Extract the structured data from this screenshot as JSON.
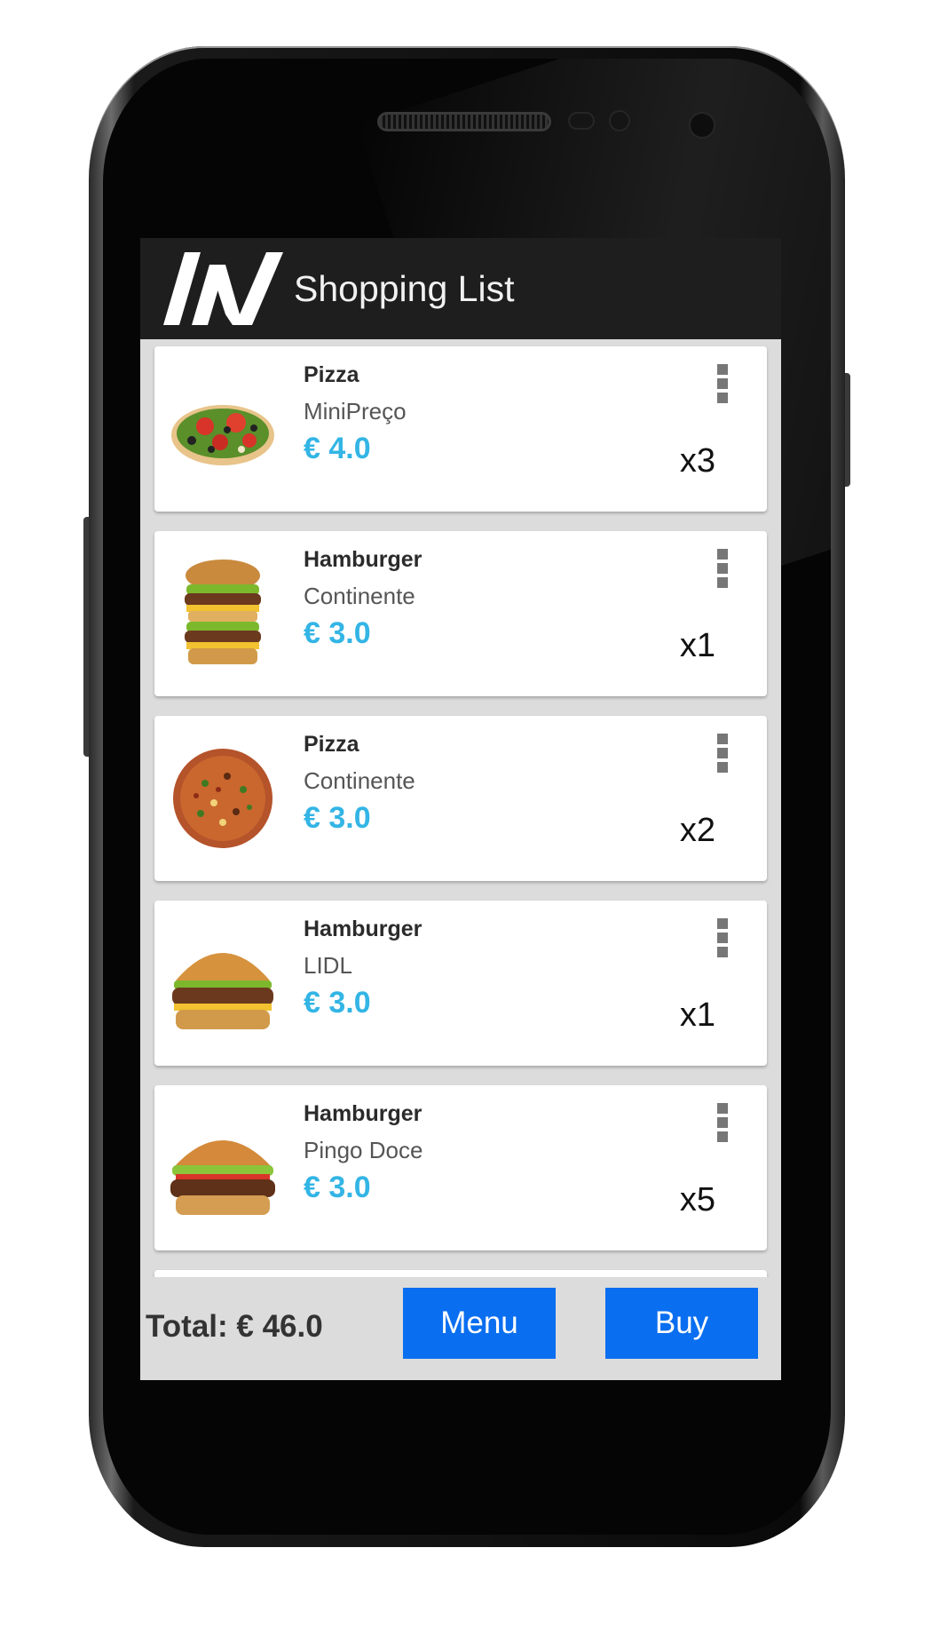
{
  "app": {
    "title": "Shopping List",
    "logo": "app-logo-icon"
  },
  "items": [
    {
      "name": "Pizza",
      "store": "MiniPreço",
      "price": "€ 4.0",
      "qty": "x3",
      "image": "pizza-salad-image"
    },
    {
      "name": "Hamburger",
      "store": "Continente",
      "price": "€ 3.0",
      "qty": "x1",
      "image": "double-burger-image"
    },
    {
      "name": "Pizza",
      "store": "Continente",
      "price": "€ 3.0",
      "qty": "x2",
      "image": "pizza-image"
    },
    {
      "name": "Hamburger",
      "store": "LIDL",
      "price": "€ 3.0",
      "qty": "x1",
      "image": "burger-image"
    },
    {
      "name": "Hamburger",
      "store": "Pingo Doce",
      "price": "€ 3.0",
      "qty": "x5",
      "image": "burger-lettuce-image"
    }
  ],
  "footer": {
    "total": "Total: € 46.0",
    "menu_label": "Menu",
    "buy_label": "Buy"
  },
  "colors": {
    "action_bar": "#1e1e1e",
    "price": "#33b5e5",
    "button": "#0a6ef0",
    "background": "#dcdcdc"
  }
}
